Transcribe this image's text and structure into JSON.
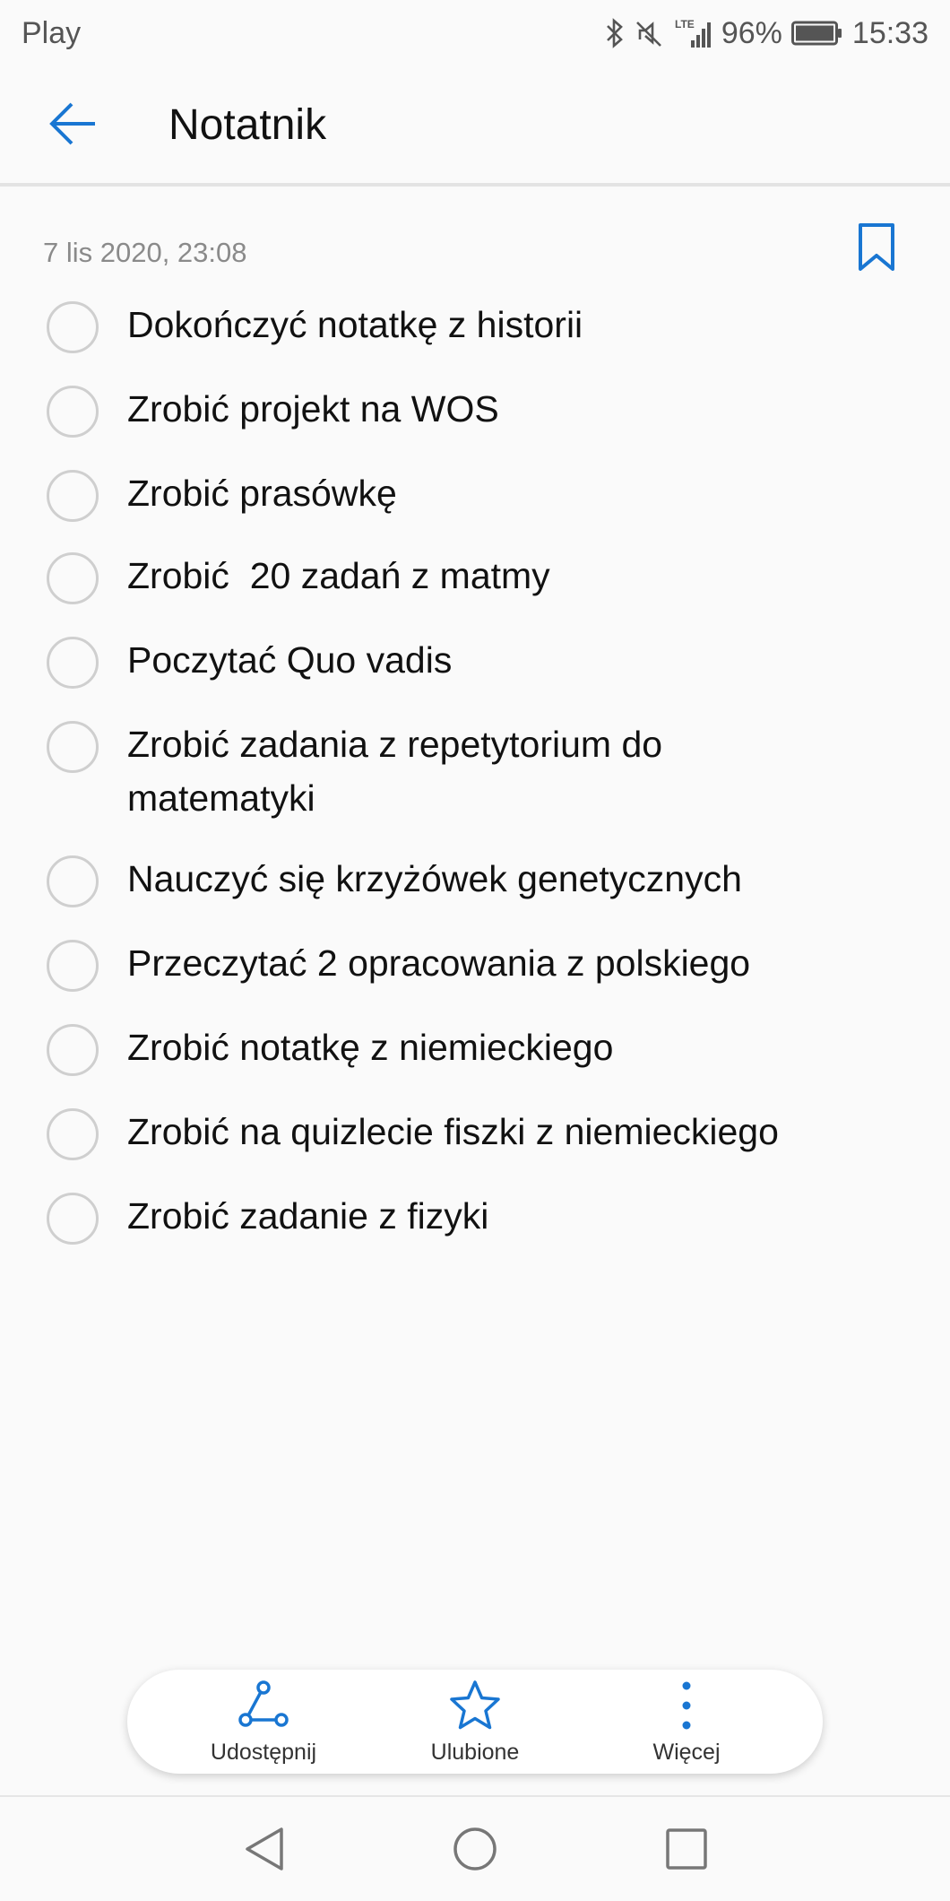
{
  "status_bar": {
    "carrier": "Play",
    "network": "LTE",
    "battery": "96%",
    "time": "15:33",
    "icons": [
      "bluetooth-icon",
      "mute-icon",
      "lte-icon",
      "signal-icon",
      "battery-icon"
    ]
  },
  "app_bar": {
    "title": "Notatnik",
    "back_icon": "arrow-left-icon"
  },
  "note": {
    "date": "7 lis 2020, 23:08",
    "bookmark_icon": "bookmark-icon",
    "items": [
      {
        "text": "Dokończyć notatkę z historii",
        "checked": false
      },
      {
        "text": "Zrobić projekt na WOS",
        "checked": false
      },
      {
        "text": "Zrobić prasówkę",
        "checked": false
      },
      {
        "text": "Zrobić  20 zadań z matmy",
        "checked": false
      },
      {
        "text": "Poczytać Quo vadis",
        "checked": false
      },
      {
        "text": "Zrobić zadania z repetytorium do matematyki",
        "checked": false
      },
      {
        "text": "Nauczyć się krzyżówek genetycznych",
        "checked": false
      },
      {
        "text": "Przeczytać 2 opracowania z polskiego",
        "checked": false
      },
      {
        "text": "Zrobić notatkę z niemieckiego",
        "checked": false
      },
      {
        "text": "Zrobić na quizlecie fiszki z niemieckiego",
        "checked": false
      },
      {
        "text": "Zrobić zadanie z fizyki",
        "checked": false
      }
    ]
  },
  "bottom_bar": {
    "share": {
      "label": "Udostępnij",
      "icon": "share-icon"
    },
    "favorite": {
      "label": "Ulubione",
      "icon": "star-icon"
    },
    "more": {
      "label": "Więcej",
      "icon": "more-vertical-icon"
    }
  },
  "nav_bar": {
    "icons": [
      "back-triangle-icon",
      "home-circle-icon",
      "recents-square-icon"
    ]
  },
  "colors": {
    "accent": "#1976d2",
    "background": "#fafafa",
    "text": "#111111",
    "muted": "#8a8a8a"
  }
}
